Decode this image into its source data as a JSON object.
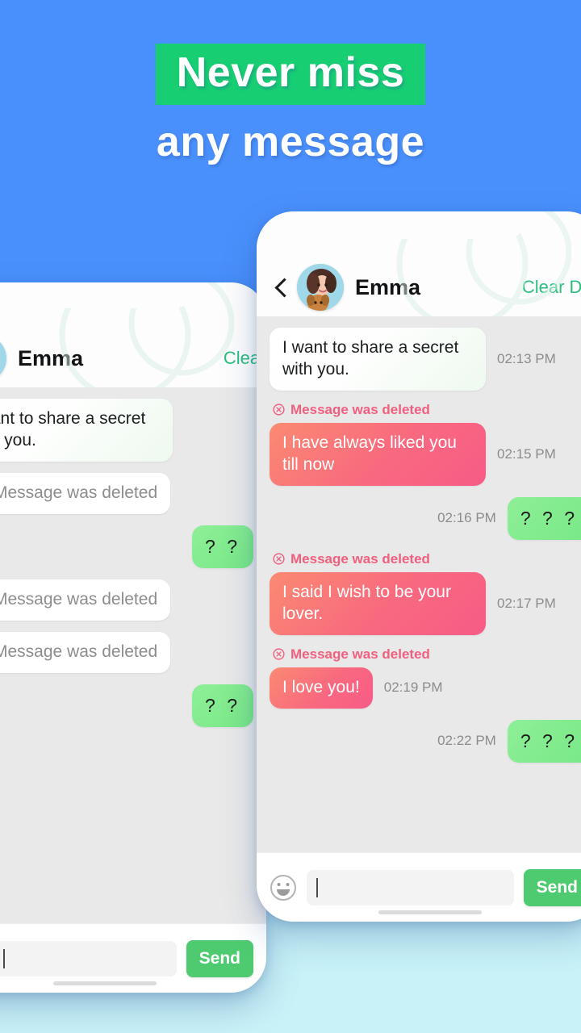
{
  "headline": {
    "line1": "Never miss",
    "line2": "any message",
    "highlight_color": "#17cf72",
    "text_color": "#ffffff"
  },
  "background": {
    "top_color": "#4a90fc",
    "bottom_color": "#c9f2f8"
  },
  "front_phone": {
    "header": {
      "back_icon": "chevron-left-icon",
      "avatar_icon": "avatar-emma",
      "contact_name": "Emma",
      "clear_data_label": "Clear Data",
      "clear_data_color": "#2bbe7e"
    },
    "messages": [
      {
        "kind": "incoming",
        "text": "I want to share a secret with you.",
        "time": "02:13 PM",
        "deleted_label": null
      },
      {
        "kind": "incoming-pink",
        "text": "I have always liked you till now",
        "time": "02:15 PM",
        "deleted_label": "Message was deleted"
      },
      {
        "kind": "outgoing",
        "text": "? ? ?",
        "time": "02:16 PM",
        "deleted_label": null
      },
      {
        "kind": "incoming-pink",
        "text": "I said I wish to be your lover.",
        "time": "02:17 PM",
        "deleted_label": "Message was deleted"
      },
      {
        "kind": "incoming-pink",
        "text": "I love you!",
        "time": "02:19 PM",
        "deleted_label": "Message was deleted"
      },
      {
        "kind": "outgoing",
        "text": "? ? ?",
        "time": "02:22 PM",
        "deleted_label": null
      }
    ],
    "input_bar": {
      "emoji_icon": "smiley-icon",
      "field_value": "",
      "send_label": "Send",
      "send_color": "#4ecb71"
    }
  },
  "back_phone": {
    "header": {
      "avatar_icon": "avatar-emma",
      "contact_name": "Emma",
      "clear_data_label": "Clear Data"
    },
    "messages": [
      {
        "kind": "incoming",
        "text": "I want to share a secret with you."
      },
      {
        "kind": "deleted",
        "text": "Message was deleted"
      },
      {
        "kind": "outgoing",
        "text": "? ?"
      },
      {
        "kind": "deleted",
        "text": "Message was deleted"
      },
      {
        "kind": "deleted",
        "text": "Message was deleted"
      },
      {
        "kind": "outgoing",
        "text": "? ?"
      }
    ],
    "input_bar": {
      "emoji_icon": "smiley-icon",
      "field_value": "",
      "send_label": "Send"
    }
  }
}
